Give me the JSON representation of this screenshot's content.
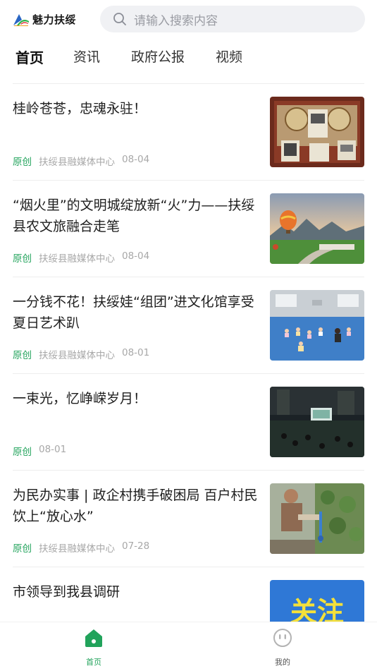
{
  "header": {
    "app_name": "魅力扶绥",
    "search_placeholder": "请输入搜索内容"
  },
  "tabs": [
    {
      "label": "首页",
      "active": true
    },
    {
      "label": "资讯",
      "active": false
    },
    {
      "label": "政府公报",
      "active": false
    },
    {
      "label": "视频",
      "active": false
    }
  ],
  "articles": [
    {
      "title": "桂岭苍苍，忠魂永驻！",
      "tag": "原创",
      "source": "扶绥县融媒体中心",
      "date": "08-04"
    },
    {
      "title": "“烟火里”的文明城绽放新“火”力——扶绥县农文旅融合走笔",
      "tag": "原创",
      "source": "扶绥县融媒体中心",
      "date": "08-04"
    },
    {
      "title": "一分钱不花！扶绥娃“组团”进文化馆享受夏日艺术趴",
      "tag": "原创",
      "source": "扶绥县融媒体中心",
      "date": "08-01"
    },
    {
      "title": "一束光，忆峥嵘岁月！",
      "tag": "原创",
      "source": "",
      "date": "08-01"
    },
    {
      "title": "为民办实事 | 政企村携手破困局 百户村民饮上“放心水”",
      "tag": "原创",
      "source": "扶绥县融媒体中心",
      "date": "07-28"
    },
    {
      "title": "市领导到我县调研",
      "tag": "",
      "source": "",
      "date": "",
      "thumb_text": "关注"
    }
  ],
  "bottom_nav": [
    {
      "label": "首页",
      "icon": "home-icon",
      "active": true
    },
    {
      "label": "我的",
      "icon": "profile-face-icon",
      "active": false
    }
  ],
  "colors": {
    "accent": "#21a35b",
    "search_bg": "#f0f1f4",
    "meta_text": "#a8a8a8"
  }
}
